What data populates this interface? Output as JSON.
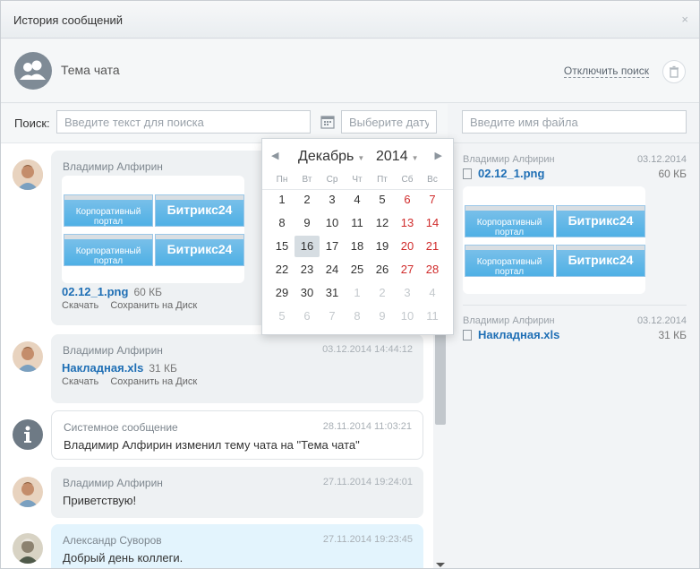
{
  "window": {
    "title": "История сообщений",
    "close_label": "×"
  },
  "chat": {
    "title": "Тема чата",
    "disable_search_label": "Отключить поиск"
  },
  "search": {
    "label": "Поиск:",
    "text_placeholder": "Введите текст для поиска",
    "date_placeholder": "Выберите дату",
    "file_placeholder": "Введите имя файла"
  },
  "messages": [
    {
      "author": "Владимир Алфирин",
      "date": "",
      "file_name": "02.12_1.png",
      "file_size": "60 КБ",
      "actions": [
        "Скачать",
        "Сохранить на Диск"
      ]
    },
    {
      "author": "Владимир Алфирин",
      "date": "03.12.2014 14:44:12",
      "file_name": "Накладная.xls",
      "file_size": "31 КБ",
      "actions": [
        "Скачать",
        "Сохранить на Диск"
      ]
    },
    {
      "author": "Системное сообщение",
      "date": "28.11.2014 11:03:21",
      "text": "Владимир Алфирин изменил тему чата на \"Тема чата\""
    },
    {
      "author": "Владимир Алфирин",
      "date": "27.11.2014 19:24:01",
      "text": "Приветствую!"
    },
    {
      "author": "Александр Суворов",
      "date": "27.11.2014 19:23:45",
      "text": "Добрый день коллеги."
    }
  ],
  "thumbnail_tiles": [
    "Корпоративный портал",
    "Битрикс24",
    "Корпоративный портал",
    "Битрикс24"
  ],
  "files": [
    {
      "author": "Владимир Алфирин",
      "date": "03.12.2014",
      "name": "02.12_1.png",
      "size": "60 КБ"
    },
    {
      "author": "Владимир Алфирин",
      "date": "03.12.2014",
      "name": "Накладная.xls",
      "size": "31 КБ"
    }
  ],
  "calendar": {
    "month": "Декабрь",
    "year": "2014",
    "weekdays": [
      "Пн",
      "Вт",
      "Ср",
      "Чт",
      "Пт",
      "Сб",
      "Вс"
    ],
    "weeks": [
      [
        "1",
        "2",
        "3",
        "4",
        "5",
        "6",
        "7"
      ],
      [
        "8",
        "9",
        "10",
        "11",
        "12",
        "13",
        "14"
      ],
      [
        "15",
        "16",
        "17",
        "18",
        "19",
        "20",
        "21"
      ],
      [
        "22",
        "23",
        "24",
        "25",
        "26",
        "27",
        "28"
      ],
      [
        "29",
        "30",
        "31",
        "1",
        "2",
        "3",
        "4"
      ],
      [
        "5",
        "6",
        "7",
        "8",
        "9",
        "10",
        "11"
      ]
    ],
    "selected_day": "16",
    "weekend_color": "#d02b2b"
  },
  "colors": {
    "link": "#1f6fb5",
    "bubble": "#eef1f3",
    "bubble_highlight": "#e3f4fd"
  }
}
